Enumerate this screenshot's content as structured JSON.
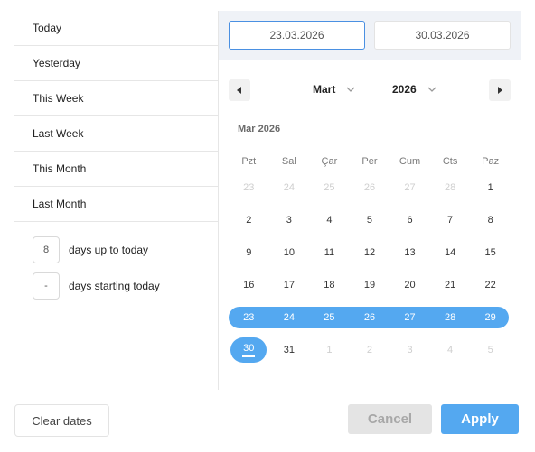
{
  "ranges": [
    "Today",
    "Yesterday",
    "This Week",
    "Last Week",
    "This Month",
    "Last Month"
  ],
  "custom": {
    "up_to_today_value": "8",
    "up_to_today_label": "days up to today",
    "starting_today_value": "-",
    "starting_today_label": "days starting today"
  },
  "inputs": {
    "start": "23.03.2026",
    "end": "30.03.2026"
  },
  "calendar": {
    "month_select": "Mart",
    "year_select": "2026",
    "caption": "Mar 2026",
    "weekdays": [
      "Pzt",
      "Sal",
      "Çar",
      "Per",
      "Cum",
      "Cts",
      "Paz"
    ],
    "weeks": [
      [
        {
          "d": "23",
          "m": true
        },
        {
          "d": "24",
          "m": true
        },
        {
          "d": "25",
          "m": true
        },
        {
          "d": "26",
          "m": true
        },
        {
          "d": "27",
          "m": true
        },
        {
          "d": "28",
          "m": true
        },
        {
          "d": "1",
          "m": false
        }
      ],
      [
        {
          "d": "2",
          "m": false
        },
        {
          "d": "3",
          "m": false
        },
        {
          "d": "4",
          "m": false
        },
        {
          "d": "5",
          "m": false
        },
        {
          "d": "6",
          "m": false
        },
        {
          "d": "7",
          "m": false
        },
        {
          "d": "8",
          "m": false
        }
      ],
      [
        {
          "d": "9",
          "m": false
        },
        {
          "d": "10",
          "m": false
        },
        {
          "d": "11",
          "m": false
        },
        {
          "d": "12",
          "m": false
        },
        {
          "d": "13",
          "m": false
        },
        {
          "d": "14",
          "m": false
        },
        {
          "d": "15",
          "m": false
        }
      ],
      [
        {
          "d": "16",
          "m": false
        },
        {
          "d": "17",
          "m": false
        },
        {
          "d": "18",
          "m": false
        },
        {
          "d": "19",
          "m": false
        },
        {
          "d": "20",
          "m": false
        },
        {
          "d": "21",
          "m": false
        },
        {
          "d": "22",
          "m": false
        }
      ],
      [
        {
          "d": "23",
          "m": false,
          "r": true
        },
        {
          "d": "24",
          "m": false,
          "r": true
        },
        {
          "d": "25",
          "m": false,
          "r": true
        },
        {
          "d": "26",
          "m": false,
          "r": true
        },
        {
          "d": "27",
          "m": false,
          "r": true
        },
        {
          "d": "28",
          "m": false,
          "r": true
        },
        {
          "d": "29",
          "m": false,
          "r": true
        }
      ],
      [
        {
          "d": "30",
          "m": false,
          "s": true
        },
        {
          "d": "31",
          "m": false
        },
        {
          "d": "1",
          "m": true
        },
        {
          "d": "2",
          "m": true
        },
        {
          "d": "3",
          "m": true
        },
        {
          "d": "4",
          "m": true
        },
        {
          "d": "5",
          "m": true
        }
      ]
    ]
  },
  "footer": {
    "clear": "Clear dates",
    "cancel": "Cancel",
    "apply": "Apply"
  },
  "colors": {
    "accent": "#54a8f0",
    "input_border_active": "#4a90e2"
  },
  "icons": {
    "prev": "caret-left-icon",
    "next": "caret-right-icon",
    "dropdown": "chevron-down-icon"
  }
}
